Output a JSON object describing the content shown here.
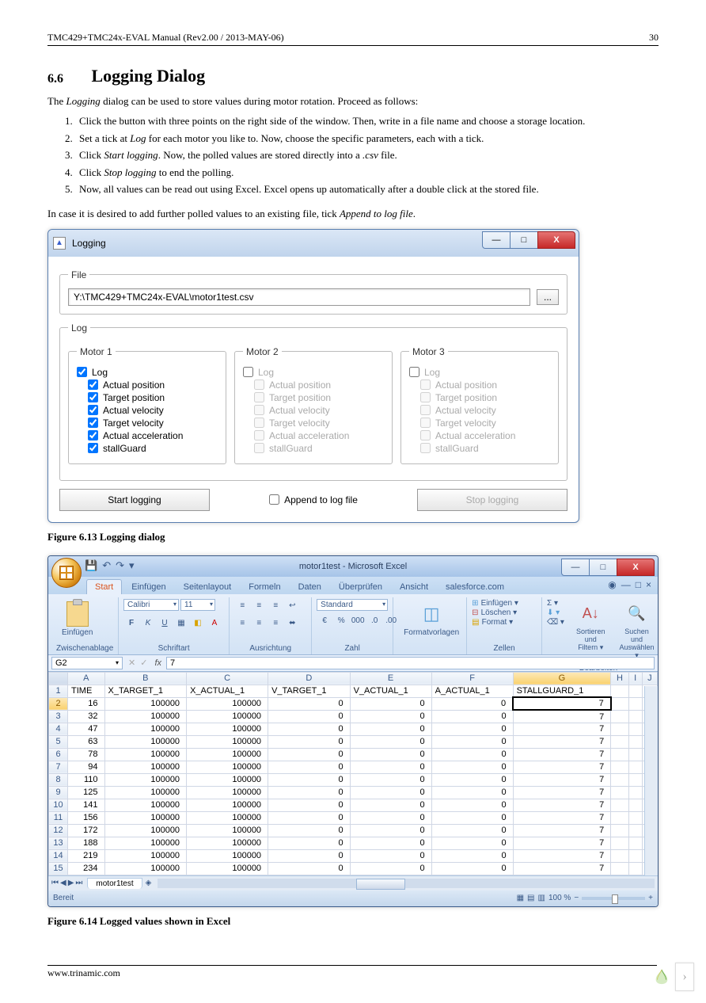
{
  "header": {
    "left": "TMC429+TMC24x-EVAL Manual (Rev2.00 / 2013-MAY-06)",
    "right": "30"
  },
  "section": {
    "num": "6.6",
    "title": "Logging Dialog"
  },
  "intro_a": "The ",
  "intro_em": "Logging",
  "intro_b": " dialog can be used to store values during motor rotation. Proceed as follows:",
  "steps": [
    "Click the button with three points on the right side of the window. Then, write in a file name and choose a storage location.",
    "Set a tick at <em>Log</em> for each motor you like to. Now, choose the specific parameters, each with a tick.",
    "Click <em>Start logging</em>. Now, the polled values are stored directly into a <em>.csv</em> file.",
    "Click <em>Stop logging</em> to end the polling.",
    "Now, all values can be read out using Excel. Excel opens up automatically after a double click at the stored file."
  ],
  "post_a": "In case it is desired to add further polled values to an existing file, tick ",
  "post_em": "Append to log file",
  "post_b": ".",
  "fig1": "Figure 6.13 Logging dialog",
  "fig2": "Figure 6.14 Logged values shown in Excel",
  "footer": "www.trinamic.com",
  "dlg": {
    "title": "Logging",
    "file_legend": "File",
    "file_path": "Y:\\TMC429+TMC24x-EVAL\\motor1test.csv",
    "browse": "...",
    "log_legend": "Log",
    "motor_labels": [
      "Motor 1",
      "Motor 2",
      "Motor 3"
    ],
    "log_label": "Log",
    "params": [
      "Actual position",
      "Target position",
      "Actual velocity",
      "Target velocity",
      "Actual acceleration",
      "stallGuard"
    ],
    "motor_enabled": [
      true,
      false,
      false
    ],
    "motor_checked": [
      [
        true,
        true,
        true,
        true,
        true,
        true
      ],
      [
        false,
        false,
        false,
        false,
        false,
        false
      ],
      [
        false,
        false,
        false,
        false,
        false,
        false
      ]
    ],
    "start": "Start logging",
    "append": "Append to log file",
    "stop": "Stop logging"
  },
  "excel": {
    "title": "motor1test - Microsoft Excel",
    "tabs": [
      "Start",
      "Einfügen",
      "Seitenlayout",
      "Formeln",
      "Daten",
      "Überprüfen",
      "Ansicht",
      "salesforce.com"
    ],
    "active_tab": 0,
    "groups": {
      "clipboard": {
        "paste": "Einfügen",
        "label": "Zwischenablage"
      },
      "font": {
        "name": "Calibri",
        "size": "11",
        "label": "Schriftart"
      },
      "align": {
        "label": "Ausrichtung"
      },
      "number": {
        "combo": "Standard",
        "label": "Zahl"
      },
      "styles": {
        "big": "Formatvorlagen",
        "label": ""
      },
      "cells": {
        "r1": "Einfügen ▾",
        "r2": "Löschen ▾",
        "r3": "Format ▾",
        "label": "Zellen"
      },
      "editing": {
        "sort": "Sortieren\nund Filtern ▾",
        "find": "Suchen und\nAuswählen ▾",
        "label": "Bearbeiten"
      }
    },
    "namebox": "G2",
    "formula": "7",
    "columns": [
      "A",
      "B",
      "C",
      "D",
      "E",
      "F",
      "G",
      "H",
      "I",
      "J"
    ],
    "headers_row": [
      "TIME",
      "X_TARGET_1",
      "X_ACTUAL_1",
      "V_TARGET_1",
      "V_ACTUAL_1",
      "A_ACTUAL_1",
      "STALLGUARD_1",
      "",
      "",
      ""
    ],
    "sel_cell": {
      "row": 2,
      "col": "G"
    },
    "chart_data": {
      "type": "table",
      "columns": [
        "TIME",
        "X_TARGET_1",
        "X_ACTUAL_1",
        "V_TARGET_1",
        "V_ACTUAL_1",
        "A_ACTUAL_1",
        "STALLGUARD_1"
      ],
      "rows": [
        [
          16,
          100000,
          100000,
          0,
          0,
          0,
          7
        ],
        [
          32,
          100000,
          100000,
          0,
          0,
          0,
          7
        ],
        [
          47,
          100000,
          100000,
          0,
          0,
          0,
          7
        ],
        [
          63,
          100000,
          100000,
          0,
          0,
          0,
          7
        ],
        [
          78,
          100000,
          100000,
          0,
          0,
          0,
          7
        ],
        [
          94,
          100000,
          100000,
          0,
          0,
          0,
          7
        ],
        [
          110,
          100000,
          100000,
          0,
          0,
          0,
          7
        ],
        [
          125,
          100000,
          100000,
          0,
          0,
          0,
          7
        ],
        [
          141,
          100000,
          100000,
          0,
          0,
          0,
          7
        ],
        [
          156,
          100000,
          100000,
          0,
          0,
          0,
          7
        ],
        [
          172,
          100000,
          100000,
          0,
          0,
          0,
          7
        ],
        [
          188,
          100000,
          100000,
          0,
          0,
          0,
          7
        ],
        [
          219,
          100000,
          100000,
          0,
          0,
          0,
          7
        ],
        [
          234,
          100000,
          100000,
          0,
          0,
          0,
          7
        ]
      ]
    },
    "sheet": "motor1test",
    "status": "Bereit",
    "zoom": "100 %"
  }
}
